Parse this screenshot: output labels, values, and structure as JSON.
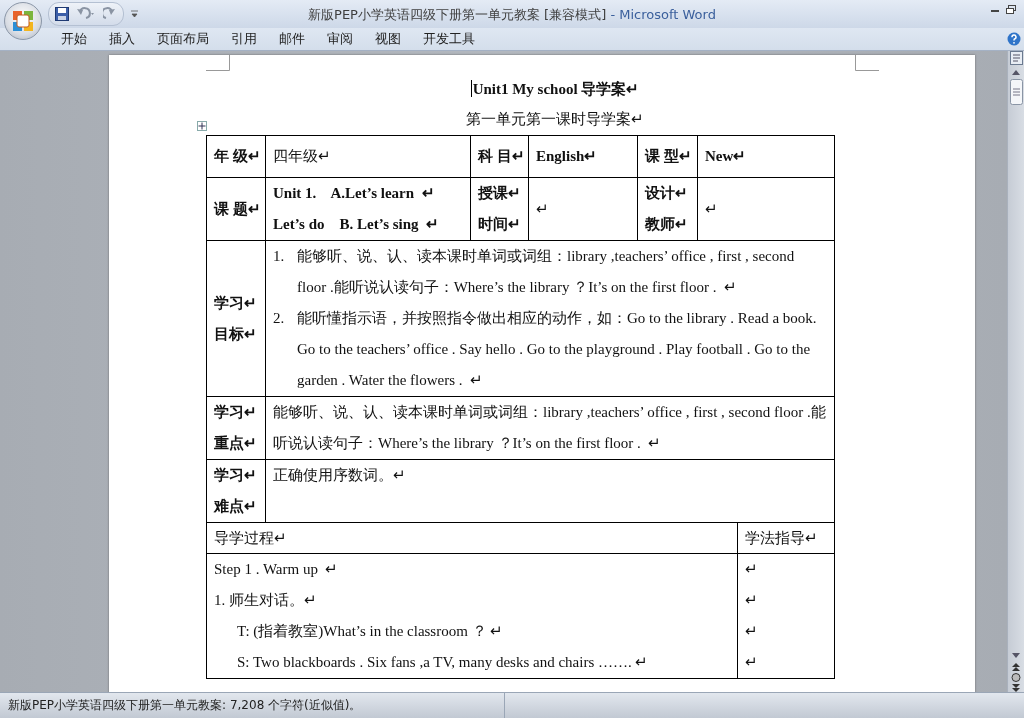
{
  "window": {
    "title": "新版PEP小学英语四级下册第一单元教案 [兼容模式]",
    "separator": "-",
    "app": "Microsoft Word"
  },
  "ribbon_tabs": [
    "开始",
    "插入",
    "页面布局",
    "引用",
    "邮件",
    "审阅",
    "视图",
    "开发工具"
  ],
  "document": {
    "title": "Unit1 My school 导学案↵",
    "subtitle": "第一单元第一课时导学案↵",
    "info_table": [
      [
        {
          "kind": "label",
          "paragraphs": [
            "年 级↵"
          ]
        },
        {
          "kind": "value",
          "paragraphs": [
            "四年级↵"
          ]
        },
        {
          "kind": "label",
          "paragraphs": [
            "科 目↵"
          ]
        },
        {
          "kind": "value",
          "bold": true,
          "paragraphs": [
            "English↵"
          ]
        },
        {
          "kind": "label",
          "paragraphs": [
            "课 型↵"
          ]
        },
        {
          "kind": "value",
          "bold": true,
          "paragraphs": [
            "New↵"
          ]
        }
      ],
      [
        {
          "kind": "label",
          "paragraphs": [
            "课 题↵"
          ]
        },
        {
          "kind": "value",
          "bold": true,
          "paragraphs": [
            "Unit 1.    A.Let’s learn  ↵",
            "Let’s do    B. Let’s sing  ↵"
          ]
        },
        {
          "kind": "label",
          "paragraphs": [
            "授课↵",
            "时间↵"
          ]
        },
        {
          "kind": "value",
          "paragraphs": [
            "↵"
          ]
        },
        {
          "kind": "label",
          "paragraphs": [
            "设计↵",
            "教师↵"
          ]
        },
        {
          "kind": "value",
          "paragraphs": [
            "↵"
          ]
        }
      ],
      [
        {
          "kind": "label",
          "paragraphs": [
            "学习↵",
            "目标↵"
          ]
        },
        {
          "kind": "list",
          "items": [
            {
              "number": "1.",
              "text": "能够听、说、认、读本课时单词或词组：library ,teachers’ office , first , second floor .能听说认读句子：Where’s the library ？It’s on the first floor .  ↵"
            },
            {
              "number": "2.",
              "text": "能听懂指示语，并按照指令做出相应的动作，如：Go to the library . Read a book. Go to the teachers’ office . Say hello . Go to the playground . Play football . Go to the garden . Water the flowers .  ↵"
            }
          ]
        }
      ],
      [
        {
          "kind": "label",
          "paragraphs": [
            "学习↵",
            "重点↵"
          ]
        },
        {
          "kind": "wide",
          "paragraphs": [
            "能够听、说、认、读本课时单词或词组：library ,teachers’ office , first , second floor .能听说认读句子：Where’s the library ？It’s on the first floor .  ↵"
          ]
        }
      ],
      [
        {
          "kind": "label",
          "paragraphs": [
            "学习↵",
            "难点↵"
          ]
        },
        {
          "kind": "wide",
          "paragraphs": [
            "正确使用序数词。↵"
          ]
        }
      ]
    ],
    "process_table": {
      "columns": [
        "导学过程↵",
        "学法指导↵"
      ],
      "lines": [
        {
          "kind": "step",
          "text": "Step 1 . Warm up  ↵",
          "guidance": "↵"
        },
        {
          "kind": "step",
          "text": "1. 师生对话。↵",
          "guidance": "↵"
        },
        {
          "kind": "dialogue",
          "text": "T: (指着教室)What’s in the classroom ？ ↵",
          "guidance": "↵"
        },
        {
          "kind": "dialogue",
          "text": "S: Two blackboards . Six fans ,a TV, many desks and chairs ……. ↵",
          "guidance": "↵"
        }
      ]
    }
  },
  "status_bar": {
    "text": "新版PEP小学英语四级下册第一单元教案: 7,208 个字符(近似值)。"
  }
}
